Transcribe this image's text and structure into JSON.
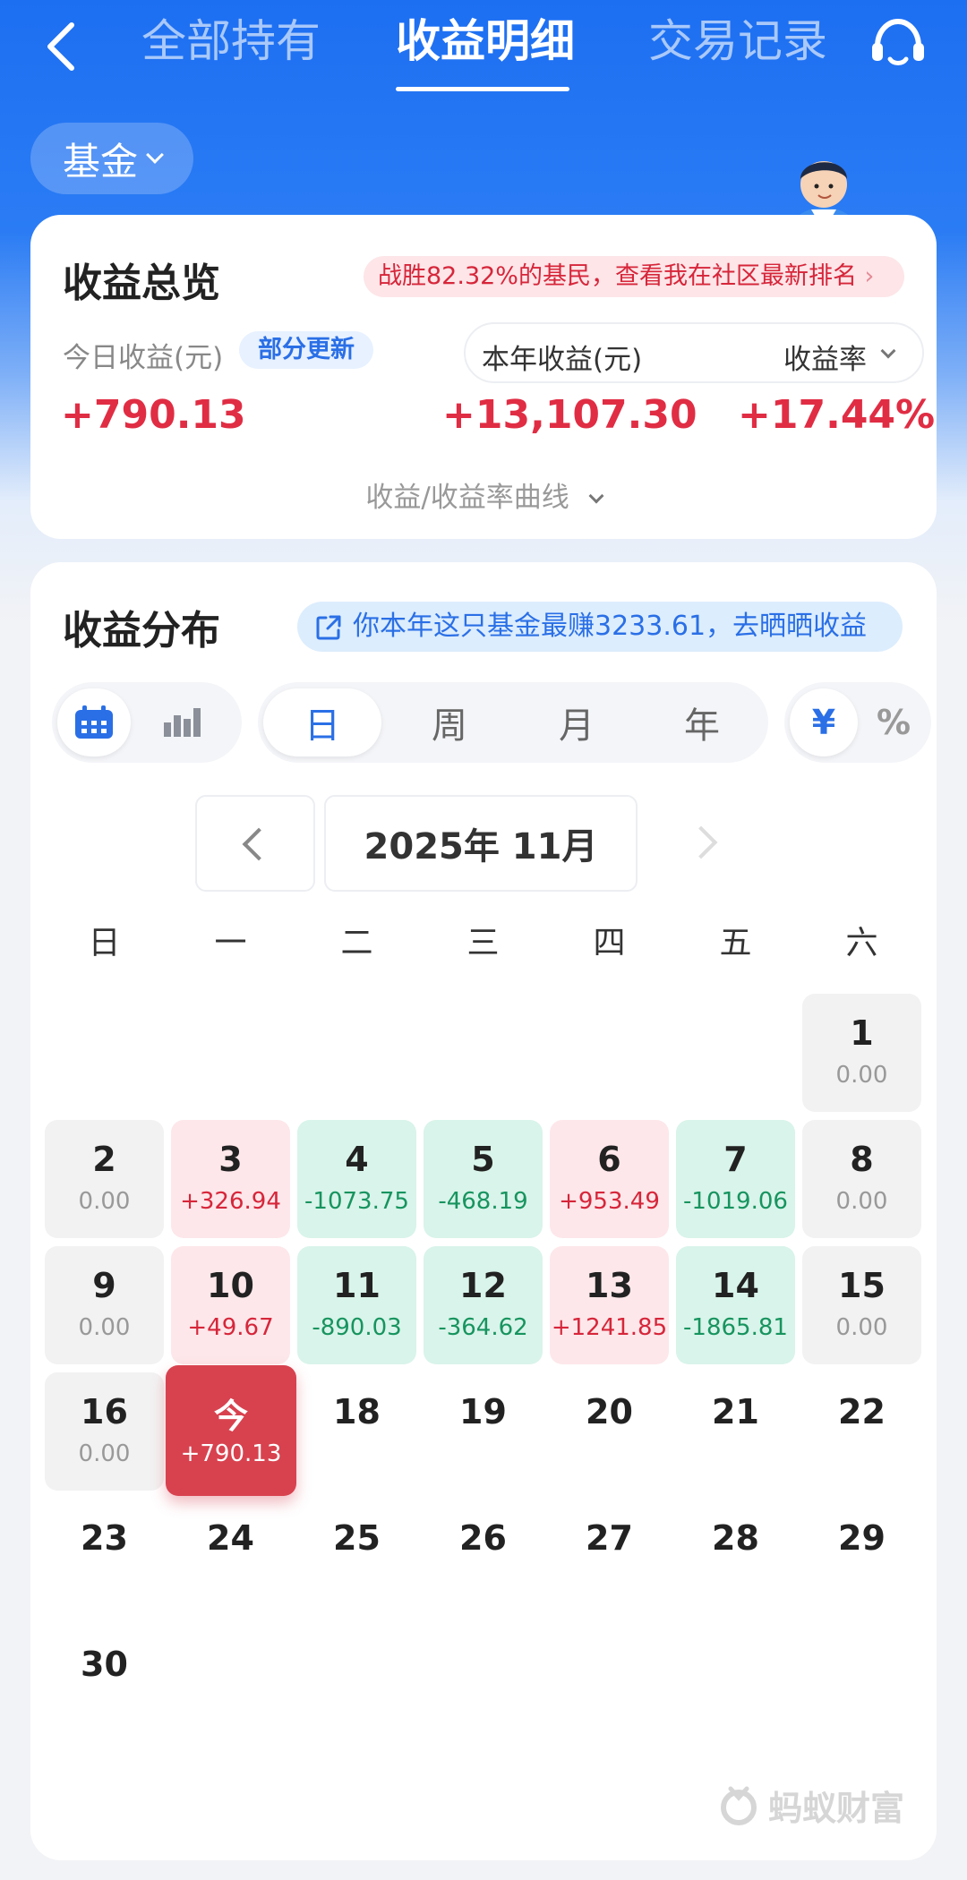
{
  "header": {
    "tabs": [
      {
        "label": "全部持有"
      },
      {
        "label": "收益明细"
      },
      {
        "label": "交易记录"
      }
    ],
    "active_tab": "收益明细"
  },
  "filter": {
    "label": "基金"
  },
  "overview": {
    "title": "收益总览",
    "rank_text": "战胜82.32%的基民，查看我在社区最新排名",
    "today_label": "今日收益(元)",
    "partial_badge": "部分更新",
    "year_label": "本年收益(元)",
    "rate_label": "收益率",
    "today_value": "+790.13",
    "year_value": "+13,107.30",
    "rate_value": "+17.44%",
    "curve_link": "收益/收益率曲线"
  },
  "distribution": {
    "title": "收益分布",
    "share_text": "你本年这只基金最赚3233.61，去晒晒收益",
    "periods": [
      "日",
      "周",
      "月",
      "年"
    ],
    "selected_period": "日",
    "units": [
      "¥",
      "%"
    ],
    "selected_unit": "¥",
    "month_label": "2025年 11月",
    "weekdays": [
      "日",
      "一",
      "二",
      "三",
      "四",
      "五",
      "六"
    ],
    "days": [
      {
        "d": "1",
        "v": "0.00",
        "t": "zero"
      },
      {
        "d": "2",
        "v": "0.00",
        "t": "zero"
      },
      {
        "d": "3",
        "v": "+326.94",
        "t": "pos"
      },
      {
        "d": "4",
        "v": "-1073.75",
        "t": "neg"
      },
      {
        "d": "5",
        "v": "-468.19",
        "t": "neg"
      },
      {
        "d": "6",
        "v": "+953.49",
        "t": "pos"
      },
      {
        "d": "7",
        "v": "-1019.06",
        "t": "neg"
      },
      {
        "d": "8",
        "v": "0.00",
        "t": "zero"
      },
      {
        "d": "9",
        "v": "0.00",
        "t": "zero"
      },
      {
        "d": "10",
        "v": "+49.67",
        "t": "pos"
      },
      {
        "d": "11",
        "v": "-890.03",
        "t": "neg"
      },
      {
        "d": "12",
        "v": "-364.62",
        "t": "neg"
      },
      {
        "d": "13",
        "v": "+1241.85",
        "t": "pos"
      },
      {
        "d": "14",
        "v": "-1865.81",
        "t": "neg"
      },
      {
        "d": "15",
        "v": "0.00",
        "t": "zero"
      },
      {
        "d": "16",
        "v": "0.00",
        "t": "zero"
      },
      {
        "d": "今",
        "v": "+790.13",
        "t": "today"
      },
      {
        "d": "18",
        "v": "",
        "t": "plain"
      },
      {
        "d": "19",
        "v": "",
        "t": "plain"
      },
      {
        "d": "20",
        "v": "",
        "t": "plain"
      },
      {
        "d": "21",
        "v": "",
        "t": "plain"
      },
      {
        "d": "22",
        "v": "",
        "t": "plain"
      },
      {
        "d": "23",
        "v": "",
        "t": "plain"
      },
      {
        "d": "24",
        "v": "",
        "t": "plain"
      },
      {
        "d": "25",
        "v": "",
        "t": "plain"
      },
      {
        "d": "26",
        "v": "",
        "t": "plain"
      },
      {
        "d": "27",
        "v": "",
        "t": "plain"
      },
      {
        "d": "28",
        "v": "",
        "t": "plain"
      },
      {
        "d": "29",
        "v": "",
        "t": "plain"
      },
      {
        "d": "30",
        "v": "",
        "t": "plain"
      }
    ],
    "first_weekday_index": 6
  },
  "watermark": "蚂蚁财富",
  "colors": {
    "brand_blue": "#1d6ff2",
    "gain_red": "#e02d44",
    "loss_green": "#17945f",
    "today_red": "#d8424f"
  }
}
